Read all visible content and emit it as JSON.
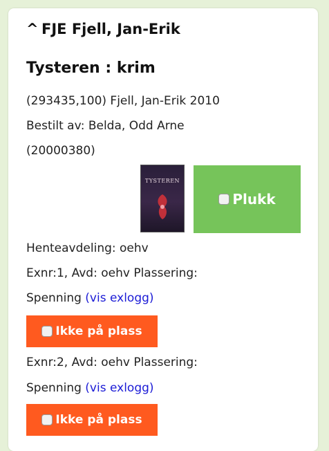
{
  "item": {
    "author_heading": "FJE Fjell, Jan-Erik",
    "caret_icon": "^",
    "title": "Tysteren : krim",
    "record_line": "(293435,100) Fjell, Jan-Erik 2010",
    "ordered_by": "Bestilt av: Belda, Odd Arne",
    "ordered_id": "(20000380)",
    "cover_text": "TYSTEREN",
    "plukk_label": "Plukk",
    "pickup_branch": "Henteavdeling: oehv"
  },
  "copies": [
    {
      "info": "Exnr:1, Avd: oehv Plassering:",
      "location": "Spenning ",
      "log_link": "(vis exlogg)",
      "not_in_place_label": "Ikke på plass"
    },
    {
      "info": "Exnr:2, Avd: oehv Plassering:",
      "location": "Spenning ",
      "log_link": "(vis exlogg)",
      "not_in_place_label": "Ikke på plass"
    }
  ],
  "colors": {
    "page_bg": "#e6f1d8",
    "plukk_green": "#76c45a",
    "ikke_orange": "#ff5a1f",
    "link_blue": "#1b1bd6"
  }
}
